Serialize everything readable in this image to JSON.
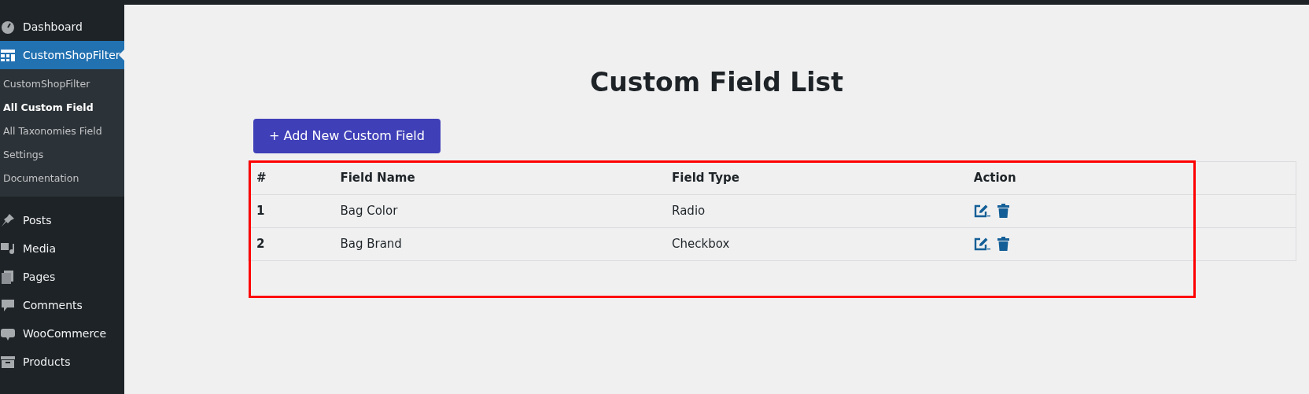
{
  "sidebar": {
    "items": [
      {
        "label": "Dashboard",
        "selected": false
      },
      {
        "label": "CustomShopFilter",
        "selected": true,
        "children": [
          {
            "label": "CustomShopFilter",
            "selected": false
          },
          {
            "label": "All Custom Field",
            "selected": true
          },
          {
            "label": "All Taxonomies Field",
            "selected": false
          },
          {
            "label": "Settings",
            "selected": false
          },
          {
            "label": "Documentation",
            "selected": false
          }
        ]
      },
      {
        "label": "Posts",
        "selected": false
      },
      {
        "label": "Media",
        "selected": false
      },
      {
        "label": "Pages",
        "selected": false
      },
      {
        "label": "Comments",
        "selected": false
      },
      {
        "label": "WooCommerce",
        "selected": false
      },
      {
        "label": "Products",
        "selected": false
      }
    ]
  },
  "page": {
    "title": "Custom Field List",
    "add_button": "+ Add New Custom Field"
  },
  "table": {
    "columns": [
      "#",
      "Field Name",
      "Field Type",
      "Action"
    ],
    "rows": [
      {
        "index": "1",
        "name": "Bag Color",
        "type": "Radio"
      },
      {
        "index": "2",
        "name": "Bag Brand",
        "type": "Checkbox"
      }
    ]
  },
  "highlight": {
    "color": "#ff0000"
  }
}
